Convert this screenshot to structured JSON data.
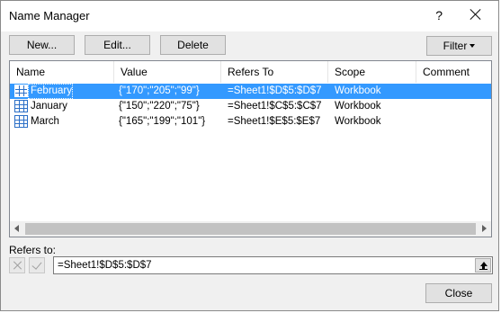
{
  "window": {
    "title": "Name Manager",
    "help": "?"
  },
  "toolbar": {
    "new_label": "New...",
    "edit_label": "Edit...",
    "delete_label": "Delete",
    "filter_label": "Filter"
  },
  "columns": [
    "Name",
    "Value",
    "Refers To",
    "Scope",
    "Comment"
  ],
  "rows": [
    {
      "name": "February",
      "value": "{\"170\";\"205\";\"99\"}",
      "refers_to": "=Sheet1!$D$5:$D$7",
      "scope": "Workbook",
      "comment": "",
      "selected": true
    },
    {
      "name": "January",
      "value": "{\"150\";\"220\";\"75\"}",
      "refers_to": "=Sheet1!$C$5:$C$7",
      "scope": "Workbook",
      "comment": "",
      "selected": false
    },
    {
      "name": "March",
      "value": "{\"165\";\"199\";\"101\"}",
      "refers_to": "=Sheet1!$E$5:$E$7",
      "scope": "Workbook",
      "comment": "",
      "selected": false
    }
  ],
  "refers": {
    "label": "Refers to:",
    "value": "=Sheet1!$D$5:$D$7"
  },
  "footer": {
    "close_label": "Close"
  },
  "colors": {
    "selection": "#3399ff",
    "button_face": "#e1e1e1",
    "dialog_bg": "#f0f0f0"
  }
}
